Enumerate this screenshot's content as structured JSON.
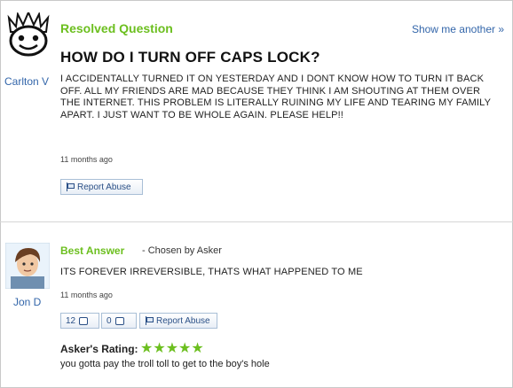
{
  "question": {
    "status": "Resolved Question",
    "show_another": "Show me another »",
    "asker": "Carlton V",
    "title": "HOW DO I TURN OFF CAPS LOCK?",
    "body": "I ACCIDENTALLY TURNED IT ON YESTERDAY AND I DONT KNOW HOW TO TURN IT BACK OFF. ALL MY FRIENDS ARE MAD BECAUSE THEY THINK I AM SHOUTING AT THEM OVER THE INTERNET. THIS PROBLEM IS LITERALLY RUINING MY LIFE AND TEARING MY FAMILY APART. I JUST WANT TO BE WHOLE AGAIN. PLEASE HELP!!",
    "time": "11 months ago",
    "report_abuse": "Report Abuse"
  },
  "answer": {
    "label": "Best Answer",
    "chosen_by": "- Chosen by Asker",
    "answerer": "Jon D",
    "body": "ITS FOREVER IRREVERSIBLE, THATS WHAT HAPPENED TO ME",
    "time": "11 months ago",
    "thumbs_up": "12",
    "thumbs_down": "0",
    "report_abuse": "Report Abuse",
    "rating_label": "Asker's Rating:",
    "stars": "★★★★★",
    "comment": "you gotta pay the troll toll to get to the boy's hole"
  },
  "colors": {
    "accent_green": "#6cbf1f",
    "link_blue": "#3366aa"
  }
}
